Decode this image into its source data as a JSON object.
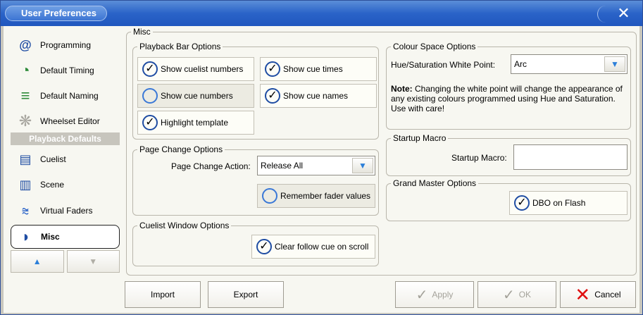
{
  "window": {
    "title": "User Preferences",
    "close_glyph": "✕"
  },
  "sidebar": {
    "items": [
      {
        "label": "Programming",
        "icon": "programming-icon",
        "glyph": "@"
      },
      {
        "label": "Default Timing",
        "icon": "clock-icon",
        "glyph": "◔"
      },
      {
        "label": "Default Naming",
        "icon": "naming-icon",
        "glyph": "≡"
      },
      {
        "label": "Wheelset Editor",
        "icon": "wheelset-icon",
        "glyph": "❋"
      },
      {
        "label": "Cuelist",
        "icon": "cuelist-icon",
        "glyph": "▤"
      },
      {
        "label": "Scene",
        "icon": "scene-icon",
        "glyph": "▥"
      },
      {
        "label": "Virtual Faders",
        "icon": "virtual-faders-icon",
        "glyph": "⩬"
      },
      {
        "label": "Misc",
        "icon": "misc-icon",
        "glyph": "◗"
      }
    ],
    "section_header": "Playback Defaults",
    "up_glyph": "▲",
    "down_glyph": "▼"
  },
  "misc": {
    "title": "Misc",
    "playback_bar": {
      "title": "Playback Bar Options",
      "show_cuelist_numbers": "Show cuelist numbers",
      "show_cue_times": "Show cue times",
      "show_cue_numbers": "Show cue numbers",
      "show_cue_names": "Show cue names",
      "highlight_template": "Highlight template",
      "values": {
        "show_cuelist_numbers": true,
        "show_cue_times": true,
        "show_cue_numbers": false,
        "show_cue_names": true,
        "highlight_template": true
      }
    },
    "page_change": {
      "title": "Page Change Options",
      "action_label": "Page Change Action:",
      "action_value": "Release All",
      "remember_fader_values": "Remember fader values",
      "remember_value": false
    },
    "cuelist_window": {
      "title": "Cuelist Window Options",
      "clear_follow_cue": "Clear follow cue on scroll",
      "clear_value": true
    },
    "colour_space": {
      "title": "Colour Space Options",
      "white_point_label": "Hue/Saturation White Point:",
      "white_point_value": "Arc",
      "note_bold": "Note:",
      "note_text": " Changing the white point will change the appearance of any existing colours programmed using Hue and Saturation. Use with care!"
    },
    "startup_macro": {
      "title": "Startup Macro",
      "label": "Startup Macro:",
      "value": ""
    },
    "grand_master": {
      "title": "Grand Master Options",
      "dbo_on_flash": "DBO on Flash",
      "dbo_value": true
    }
  },
  "footer": {
    "import": "Import",
    "export": "Export",
    "apply": "Apply",
    "ok": "OK",
    "cancel": "Cancel"
  },
  "colors": {
    "title_blue": "#2a63c8",
    "check_blue": "#1f4da3",
    "cancel_red": "#e01010"
  }
}
